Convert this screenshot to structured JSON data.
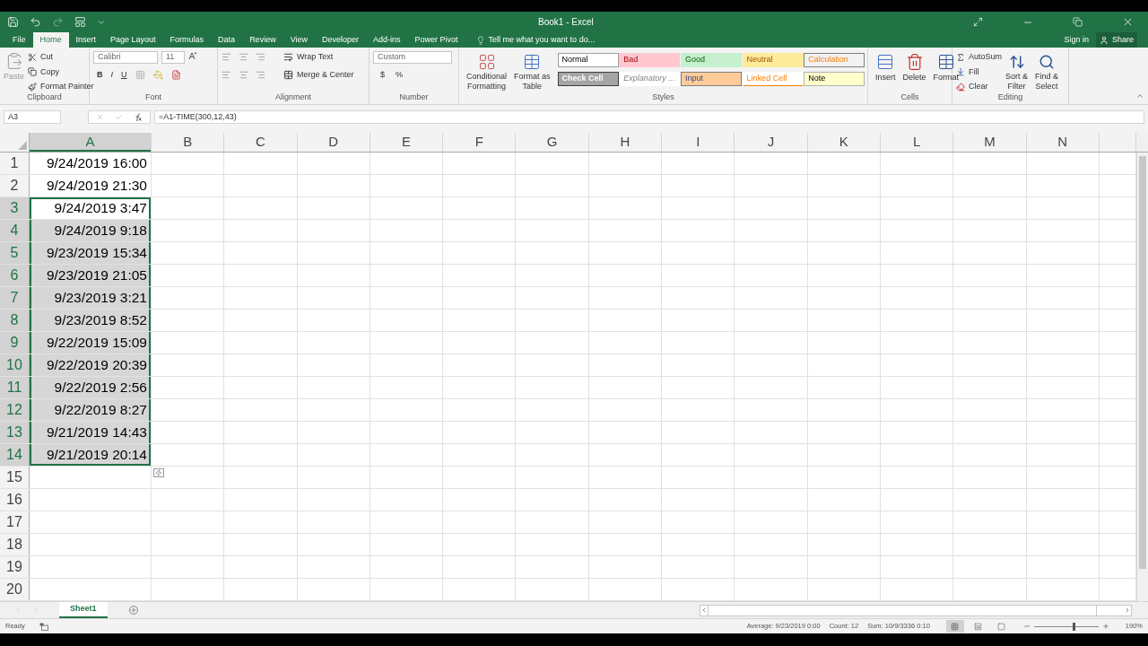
{
  "title_bar": {
    "title": "Book1 - Excel"
  },
  "menu_tabs": [
    {
      "label": "File",
      "selected": false
    },
    {
      "label": "Home",
      "selected": true
    },
    {
      "label": "Insert",
      "selected": false
    },
    {
      "label": "Page Layout",
      "selected": false
    },
    {
      "label": "Formulas",
      "selected": false
    },
    {
      "label": "Data",
      "selected": false
    },
    {
      "label": "Review",
      "selected": false
    },
    {
      "label": "View",
      "selected": false
    },
    {
      "label": "Developer",
      "selected": false
    },
    {
      "label": "Add-ins",
      "selected": false
    },
    {
      "label": "Power Pivot",
      "selected": false
    }
  ],
  "tell_me": "Tell me what you want to do...",
  "sign_in": "Sign in",
  "share": "Share",
  "ribbon": {
    "clipboard": {
      "paste": "Paste",
      "cut": "Cut",
      "copy": "Copy",
      "format_painter": "Format Painter",
      "label": "Clipboard"
    },
    "font": {
      "font_name": "Calibri",
      "font_size": "11",
      "bold": "B",
      "italic": "I",
      "underline": "U",
      "label": "Font"
    },
    "alignment": {
      "wrap_text": "Wrap Text",
      "merge": "Merge & Center",
      "label": "Alignment"
    },
    "number": {
      "format": "Custom",
      "currency": "$",
      "percent": "%",
      "label": "Number"
    },
    "styles": {
      "conditional": [
        "Conditional",
        "Formatting"
      ],
      "format_table": [
        "Format as",
        "Table"
      ],
      "label": "Styles",
      "items": [
        {
          "label": "Normal",
          "kind": "normal",
          "color": "#ffffff"
        },
        {
          "label": "Bad",
          "kind": "bad",
          "color": "#ffc7ce"
        },
        {
          "label": "Good",
          "kind": "good",
          "color": "#c6efce"
        },
        {
          "label": "Neutral",
          "kind": "neutral",
          "color": "#ffeb9c"
        },
        {
          "label": "Calculation",
          "kind": "calculation",
          "color": "#f2f2f2"
        },
        {
          "label": "Check Cell",
          "kind": "check",
          "color": "#a5a5a5"
        },
        {
          "label": "Explanatory ...",
          "kind": "explanatory",
          "color": "#ffffff"
        },
        {
          "label": "Input",
          "kind": "input",
          "color": "#ffcc99"
        },
        {
          "label": "Linked Cell",
          "kind": "linked",
          "color": "#ffffff"
        },
        {
          "label": "Note",
          "kind": "note",
          "color": "#ffffcc"
        }
      ]
    },
    "cells": {
      "insert": "Insert",
      "delete": "Delete",
      "format": "Format",
      "label": "Cells"
    },
    "editing": {
      "autosum": "AutoSum",
      "fill": "Fill",
      "clear": "Clear",
      "sort": [
        "Sort &",
        "Filter"
      ],
      "find": [
        "Find &",
        "Select"
      ],
      "label": "Editing"
    }
  },
  "formula_bar": {
    "name_box": "A3",
    "formula": "=A1-TIME(300,12,43)"
  },
  "columns": [
    {
      "label": "A",
      "selected": true
    },
    {
      "label": "B",
      "selected": false
    },
    {
      "label": "C",
      "selected": false
    },
    {
      "label": "D",
      "selected": false
    },
    {
      "label": "E",
      "selected": false
    },
    {
      "label": "F",
      "selected": false
    },
    {
      "label": "G",
      "selected": false
    },
    {
      "label": "H",
      "selected": false
    },
    {
      "label": "I",
      "selected": false
    },
    {
      "label": "J",
      "selected": false
    },
    {
      "label": "K",
      "selected": false
    },
    {
      "label": "L",
      "selected": false
    },
    {
      "label": "M",
      "selected": false
    },
    {
      "label": "N",
      "selected": false
    }
  ],
  "rows": [
    {
      "number": "1",
      "selected": false,
      "active": false,
      "value": "9/24/2019 16:00"
    },
    {
      "number": "2",
      "selected": false,
      "active": false,
      "value": "9/24/2019 21:30"
    },
    {
      "number": "3",
      "selected": true,
      "active": true,
      "value": "9/24/2019 3:47"
    },
    {
      "number": "4",
      "selected": true,
      "active": false,
      "value": "9/24/2019 9:18"
    },
    {
      "number": "5",
      "selected": true,
      "active": false,
      "value": "9/23/2019 15:34"
    },
    {
      "number": "6",
      "selected": true,
      "active": false,
      "value": "9/23/2019 21:05"
    },
    {
      "number": "7",
      "selected": true,
      "active": false,
      "value": "9/23/2019 3:21"
    },
    {
      "number": "8",
      "selected": true,
      "active": false,
      "value": "9/23/2019 8:52"
    },
    {
      "number": "9",
      "selected": true,
      "active": false,
      "value": "9/22/2019 15:09"
    },
    {
      "number": "10",
      "selected": true,
      "active": false,
      "value": "9/22/2019 20:39"
    },
    {
      "number": "11",
      "selected": true,
      "active": false,
      "value": "9/22/2019 2:56"
    },
    {
      "number": "12",
      "selected": true,
      "active": false,
      "value": "9/22/2019 8:27"
    },
    {
      "number": "13",
      "selected": true,
      "active": false,
      "value": "9/21/2019 14:43"
    },
    {
      "number": "14",
      "selected": true,
      "active": false,
      "value": "9/21/2019 20:14"
    },
    {
      "number": "15",
      "selected": false,
      "active": false
    },
    {
      "number": "16",
      "selected": false,
      "active": false
    },
    {
      "number": "17",
      "selected": false,
      "active": false
    },
    {
      "number": "18",
      "selected": false,
      "active": false
    },
    {
      "number": "19",
      "selected": false,
      "active": false
    },
    {
      "number": "20",
      "selected": false,
      "active": false
    }
  ],
  "sheet_tabs": [
    {
      "label": "Sheet1",
      "selected": true
    }
  ],
  "status_bar": {
    "status": "Ready",
    "average": "Average: 9/23/2019 0:00",
    "count": "Count: 12",
    "sum": "Sum: 10/9/3336 0:10",
    "views": [
      {
        "kind": "normal",
        "selected": true
      },
      {
        "kind": "page_layout",
        "selected": false
      },
      {
        "kind": "page_break",
        "selected": false
      }
    ],
    "zoom": {
      "level": 0.62
    },
    "zoom_label": "190%"
  }
}
